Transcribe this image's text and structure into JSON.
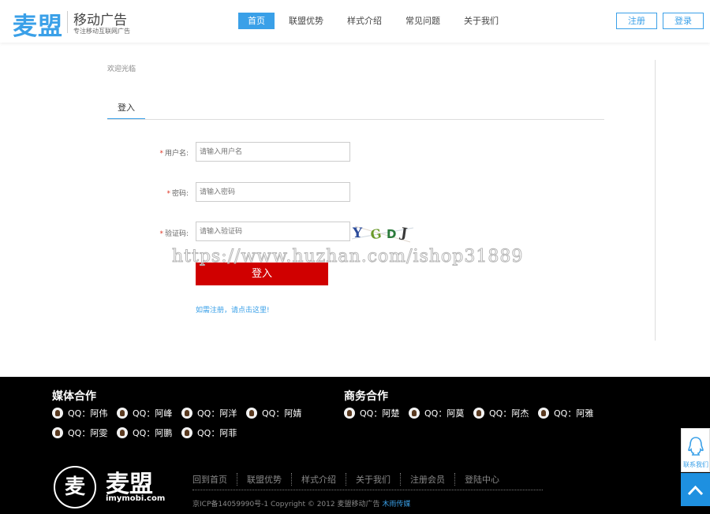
{
  "header": {
    "logo_mark": "麦盟",
    "logo_title": "移动广告",
    "logo_subtitle": "专注移动互联网广告",
    "nav": [
      "首页",
      "联盟优势",
      "样式介绍",
      "常见问题",
      "关于我们"
    ],
    "register_label": "注册",
    "login_label": "登录"
  },
  "main": {
    "welcome": "欢迎光临",
    "tab_label": "登入",
    "username_label": "用户名:",
    "username_placeholder": "请输入用户名",
    "password_label": "密码:",
    "password_placeholder": "请输入密码",
    "captcha_label": "验证码:",
    "captcha_placeholder": "请输入验证码",
    "required_mark": "*",
    "submit_label": "登入",
    "register_link": "如需注册，请点击这里!",
    "watermark": "https://www.huzhan.com/ishop31889"
  },
  "footer": {
    "media_title": "媒体合作",
    "media_contacts": [
      "QQ：阿伟",
      "QQ：阿峰",
      "QQ：阿洋",
      "QQ：阿婧",
      "QQ：阿雯",
      "QQ：阿鹏",
      "QQ：阿菲"
    ],
    "business_title": "商务合作",
    "business_contacts": [
      "QQ：阿楚",
      "QQ：阿莫",
      "QQ：阿杰",
      "QQ：阿雅"
    ],
    "logo_char": "麦",
    "logo_name": "麦盟",
    "logo_domain": "imymobi.com",
    "links": [
      "回到首页",
      "联盟优势",
      "样式介绍",
      "关于我们",
      "注册会员",
      "登陆中心"
    ],
    "copyright": "京ICP备14059990号-1  Copyright © 2012 麦盟移动广告",
    "copyright_link": "木雨传媒"
  },
  "float": {
    "contact_label": "联系我们"
  }
}
